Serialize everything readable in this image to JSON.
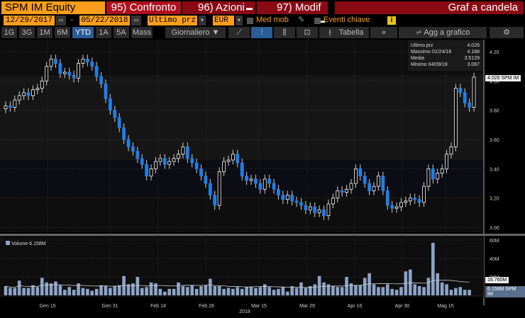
{
  "header": {
    "ticker": "SPM IM Equity",
    "compare": "95) Confronto",
    "actions": "96) Azioni",
    "edit": "97) Modif",
    "chart_type": "Graf a candela"
  },
  "controls": {
    "start_date": "12/29/2017",
    "dash": "-",
    "end_date": "05/22/2018",
    "field": "Ultimo prz",
    "currency": "EUR",
    "moving_avg": "Med mob",
    "key_events": "Eventi chiave",
    "info": "i"
  },
  "periods": [
    "1G",
    "3G",
    "1M",
    "6M",
    "YTD",
    "1A",
    "5A",
    "Mass"
  ],
  "active_period": "YTD",
  "frequency": "Giornaliero ▼",
  "toolbar": {
    "table": "Tabella",
    "collapse": "«",
    "add_to_chart": "Agg a grafico",
    "settings": "⚙"
  },
  "legend": {
    "last_label": "Ultimo prz",
    "last": "4.026",
    "high_label": "Massimo 01/24/18",
    "high": "4.188",
    "avg_label": "Media",
    "avg": "3.5129",
    "low_label": "Minimo 04/09/18",
    "low": "3.067"
  },
  "price_tag": "4.026 SPM IM",
  "volume": {
    "label": "Volume 6.158M",
    "avg_tag": "16.760M",
    "last_tag": "6.158M SPM IM"
  },
  "colors": {
    "down": "#1e7fe8",
    "up": "#ffffff",
    "volume": "#8da4c8",
    "accent": "#f99d1c"
  },
  "chart_data": [
    {
      "type": "candlestick",
      "title": "SPM IM Equity",
      "ylim": [
        3.0,
        4.2
      ],
      "yticks": [
        "4.20",
        "4.00",
        "3.80",
        "3.60",
        "3.40",
        "3.20",
        "3.00"
      ],
      "closes": [
        3.83,
        3.82,
        3.87,
        3.9,
        3.92,
        3.9,
        3.94,
        3.95,
        4.0,
        4.1,
        4.15,
        4.12,
        4.05,
        4.06,
        4.04,
        4.02,
        4.12,
        4.15,
        4.13,
        4.1,
        4.03,
        3.98,
        3.88,
        3.8,
        3.75,
        3.68,
        3.6,
        3.55,
        3.52,
        3.47,
        3.43,
        3.35,
        3.4,
        3.45,
        3.47,
        3.43,
        3.45,
        3.47,
        3.5,
        3.55,
        3.47,
        3.44,
        3.4,
        3.35,
        3.3,
        3.22,
        3.15,
        3.38,
        3.45,
        3.46,
        3.5,
        3.44,
        3.35,
        3.32,
        3.33,
        3.3,
        3.26,
        3.33,
        3.3,
        3.26,
        3.22,
        3.19,
        3.22,
        3.18,
        3.17,
        3.15,
        3.12,
        3.14,
        3.1,
        3.12,
        3.08,
        3.16,
        3.2,
        3.25,
        3.24,
        3.26,
        3.3,
        3.4,
        3.35,
        3.3,
        3.25,
        3.28,
        3.35,
        3.25,
        3.15,
        3.13,
        3.14,
        3.17,
        3.18,
        3.2,
        3.19,
        3.17,
        3.28,
        3.4,
        3.33,
        3.37,
        3.4,
        3.5,
        3.55,
        3.95,
        3.92,
        3.85,
        3.82,
        4.026
      ]
    },
    {
      "type": "bar",
      "title": "Volume",
      "ylim": [
        0,
        60
      ],
      "yticks": [
        "60M",
        "40M",
        "20M",
        "0"
      ],
      "values": [
        10,
        8,
        8,
        16,
        8,
        8,
        11,
        9,
        19,
        14,
        13,
        15,
        11,
        6,
        9,
        6,
        13,
        8,
        7,
        5,
        7,
        11,
        10,
        8,
        10,
        11,
        21,
        12,
        13,
        20,
        8,
        9,
        14,
        13,
        7,
        4,
        7,
        7,
        14,
        10,
        9,
        11,
        7,
        10,
        11,
        18,
        10,
        10,
        7,
        8,
        7,
        9,
        7,
        9,
        9,
        8,
        9,
        12,
        9,
        6,
        7,
        9,
        4,
        10,
        8,
        14,
        8,
        10,
        12,
        21,
        14,
        12,
        10,
        9,
        9,
        20,
        13,
        11,
        11,
        19,
        24,
        12,
        9,
        9,
        12,
        7,
        6,
        9,
        26,
        28,
        12,
        10,
        9,
        19,
        57,
        24,
        14,
        12,
        6,
        8,
        9,
        6,
        6
      ]
    }
  ],
  "xaxis": {
    "ticks": [
      "Gen 15",
      "Gen 31",
      "Feb 14",
      "Feb 28",
      "Mar 15",
      "Mar 29",
      "Apr 16",
      "Apr 30",
      "Mag 15"
    ],
    "year": "2018"
  }
}
